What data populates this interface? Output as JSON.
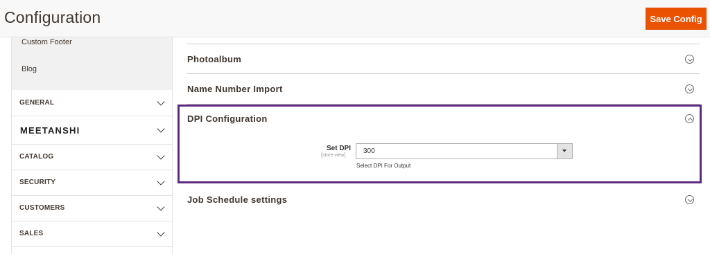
{
  "header": {
    "title": "Configuration",
    "save_label": "Save Config"
  },
  "sidebar": {
    "sub_items": [
      "Custom Footer",
      "Blog"
    ],
    "sections": [
      {
        "label": "GENERAL"
      },
      {
        "label": "MEETANSHI"
      },
      {
        "label": "CATALOG"
      },
      {
        "label": "SECURITY"
      },
      {
        "label": "CUSTOMERS"
      },
      {
        "label": "SALES"
      }
    ]
  },
  "main": {
    "groups": [
      {
        "title": "Photoalbum",
        "state": "collapsed"
      },
      {
        "title": "Name Number Import",
        "state": "collapsed"
      },
      {
        "title": "DPI Configuration",
        "state": "expanded"
      },
      {
        "title": "Job Schedule settings",
        "state": "collapsed"
      }
    ],
    "dpi_field": {
      "label": "Set DPI",
      "scope": "[store view]",
      "value": "300",
      "note": "Select DPI For Output"
    }
  },
  "colors": {
    "accent": "#eb5202",
    "highlight_border": "#5e2a7e"
  },
  "icons": {
    "group_collapsed": "chevron-down-circle-icon",
    "group_expanded": "chevron-up-circle-icon",
    "section_toggle": "chevron-down-icon",
    "select_arrow": "caret-down-icon"
  }
}
